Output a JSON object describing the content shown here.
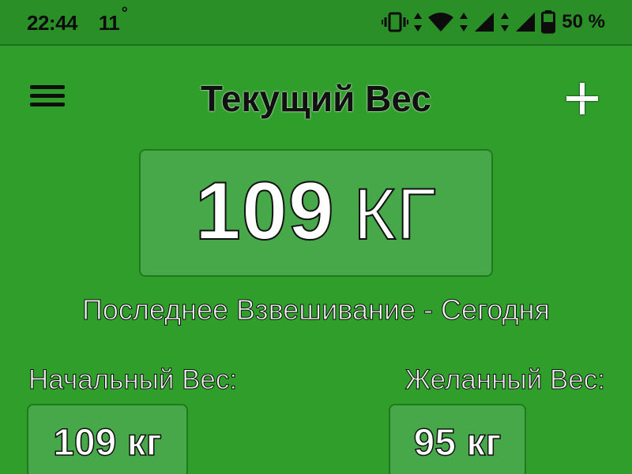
{
  "status_bar": {
    "time": "22:44",
    "temperature": "11",
    "temperature_symbol": "°",
    "battery_percent": "50 %",
    "icons": [
      "vibrate-icon",
      "data-arrows-icon",
      "wifi-icon",
      "signal-icon",
      "signal-icon",
      "battery-icon"
    ]
  },
  "toolbar": {
    "title": "Текущий Вес",
    "menu_icon": "hamburger-menu-icon",
    "add_icon": "plus-icon"
  },
  "current_weight": {
    "value": "109",
    "unit": "КГ"
  },
  "last_weigh_in": "Последнее Взвешивание - Сегодня",
  "start_weight": {
    "label": "Начальный Вес:",
    "value": "109 кг"
  },
  "goal_weight": {
    "label": "Желанный Вес:",
    "value": "95 кг"
  },
  "colors": {
    "background": "#2f9e2b",
    "status_bar": "#2b8f27",
    "box_fill": "#47a849",
    "box_border": "#1f7a1e"
  }
}
